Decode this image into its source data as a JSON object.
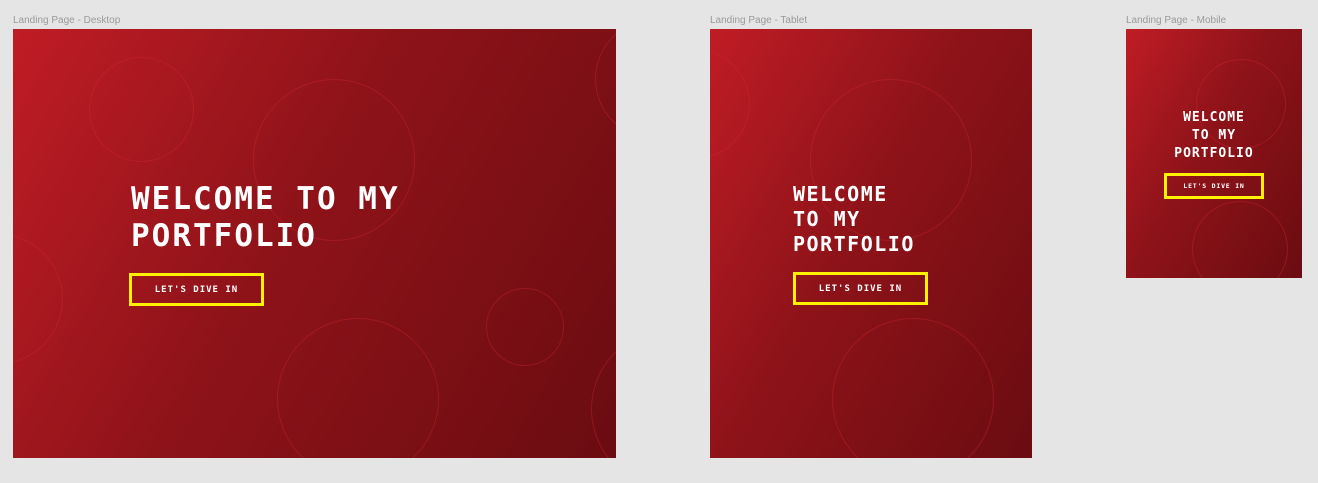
{
  "frames": {
    "desktop": {
      "label": "Landing Page - Desktop",
      "title": "Welcome to my\nportfolio",
      "cta": "Let's dive in"
    },
    "tablet": {
      "label": "Landing Page - Tablet",
      "title": "Welcome\nto my\nportfolio",
      "cta": "Let's dive in"
    },
    "mobile": {
      "label": "Landing Page - Mobile",
      "title": "Welcome\nto my\nportfolio",
      "cta": "Let's dive in"
    }
  },
  "colors": {
    "canvas_background": "#e5e5e5",
    "gradient_start": "#c01c25",
    "gradient_end": "#6a0c11",
    "button_border": "#fff200",
    "text": "#ffffff"
  }
}
